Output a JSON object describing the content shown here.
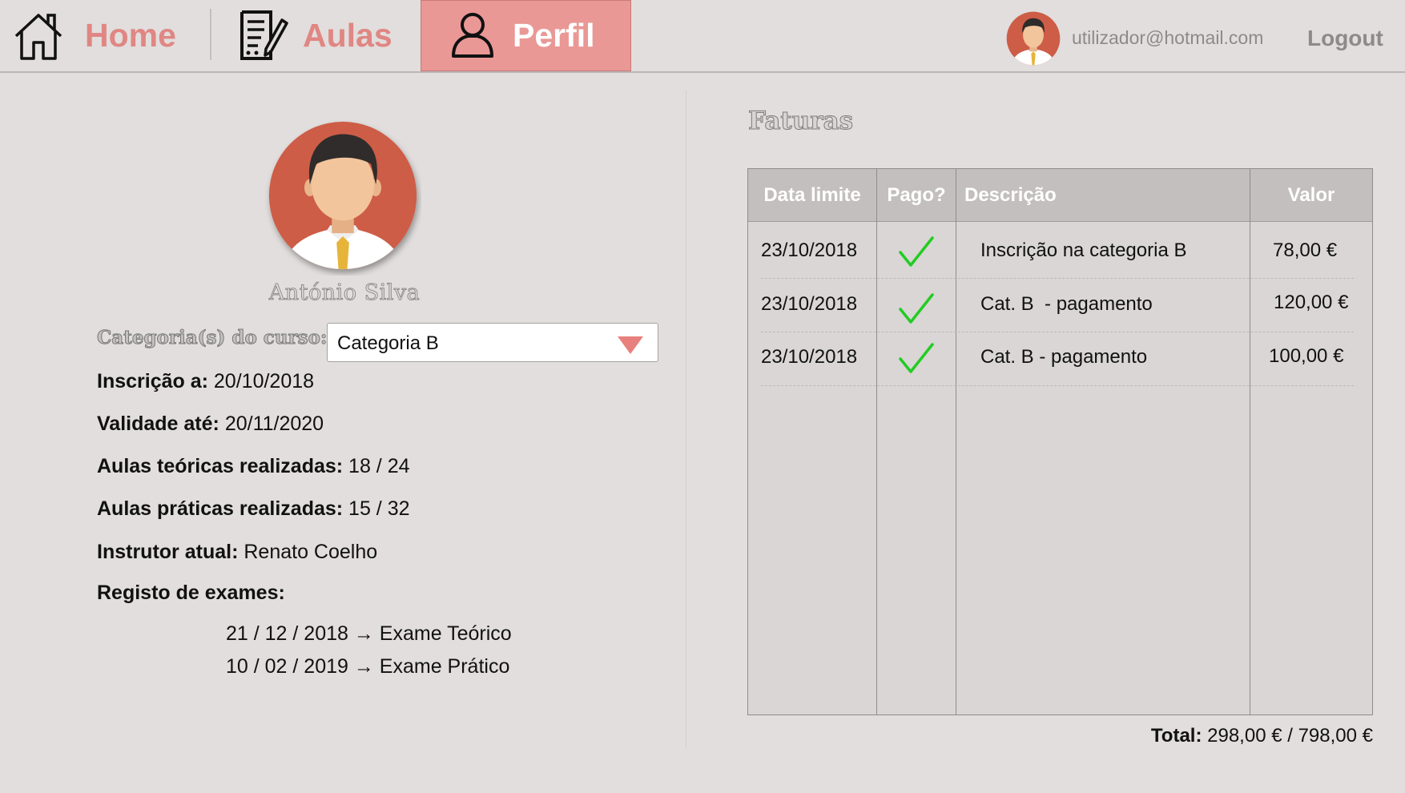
{
  "nav": {
    "home_label": "Home",
    "aulas_label": "Aulas",
    "perfil_label": "Perfil",
    "active_tab": "Perfil",
    "user_email": "utilizador@hotmail.com",
    "logout_label": "Logout"
  },
  "profile": {
    "name": "António Silva",
    "category_label": "Categoria(s) do curso:",
    "category_selected": "Categoria B",
    "fields": [
      {
        "label": "Inscrição a:",
        "value": "20/10/2018"
      },
      {
        "label": "Validade até:",
        "value": "20/11/2020"
      },
      {
        "label": "Aulas teóricas realizadas:",
        "value": "18 / 24"
      },
      {
        "label": "Aulas práticas realizadas:",
        "value": "15 / 32"
      },
      {
        "label": "Instrutor atual:",
        "value": "Renato Coelho"
      }
    ],
    "exams_label": "Registo de exames:",
    "exams": [
      "21 / 12 / 2018 → Exame Teórico",
      "10 / 02 / 2019 → Exame Prático"
    ]
  },
  "invoices": {
    "title": "Faturas",
    "headers": [
      "Data limite",
      "Pago?",
      "Descrição",
      "Valor"
    ],
    "rows": [
      {
        "date": "23/10/2018",
        "paid": true,
        "description": "Inscrição na categoria B",
        "value": "78,00 €"
      },
      {
        "date": "23/10/2018",
        "paid": true,
        "description": "Cat. B  - pagamento",
        "value": "120,00 €"
      },
      {
        "date": "23/10/2018",
        "paid": true,
        "description": "Cat. B - pagamento",
        "value": "100,00 €"
      }
    ],
    "total_label": "Total:",
    "total_value": "298,00 € / 798,00 €"
  },
  "colors": {
    "accent": "#e08683",
    "active_tab_bg": "#e99896",
    "check": "#22cc22",
    "avatar_bg": "#cd5d47"
  },
  "icons": [
    "home-icon",
    "document-edit-icon",
    "user-icon",
    "avatar-icon",
    "checkmark-icon",
    "dropdown-arrow-icon"
  ]
}
